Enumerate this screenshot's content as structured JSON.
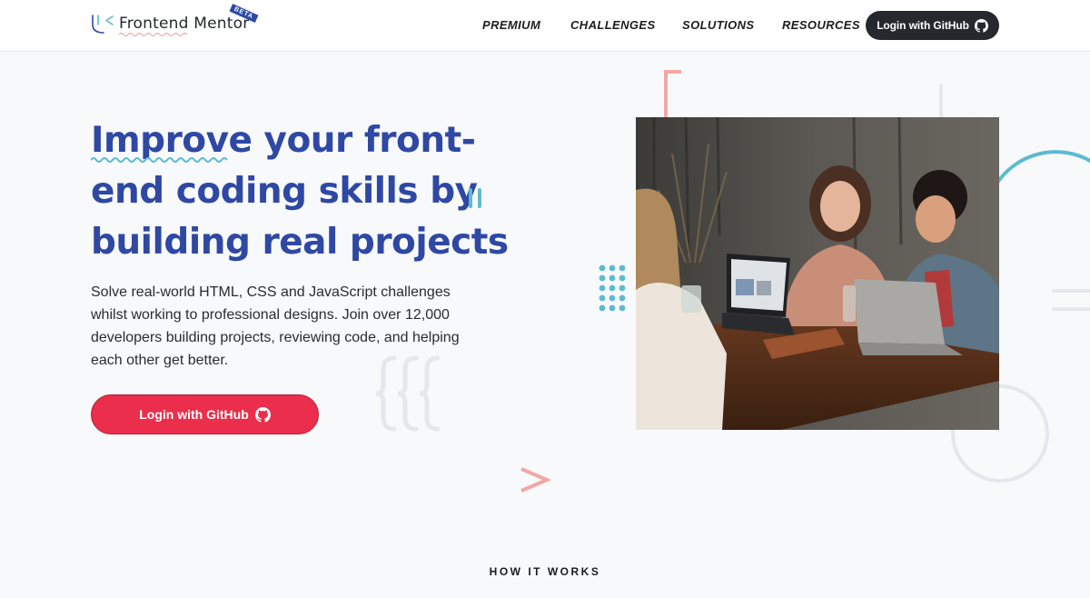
{
  "header": {
    "logo_text": "Frontend Mentor",
    "beta_badge": "BETA",
    "nav": [
      "PREMIUM",
      "CHALLENGES",
      "SOLUTIONS",
      "RESOURCES"
    ],
    "login_button": "Login with GitHub"
  },
  "hero": {
    "title_word1": "Improve",
    "title_rest": " your front-end coding skills by building real projects",
    "description": "Solve real-world HTML, CSS and JavaScript challenges whilst working to professional designs. Join over 12,000 developers building projects, reviewing code, and helping each other get better.",
    "login_button": "Login with GitHub"
  },
  "section": {
    "how_it_works": "HOW IT WORKS"
  },
  "colors": {
    "brand_blue": "#2e48a4",
    "accent_red": "#ea2e4b",
    "accent_teal": "#5cbbd0",
    "accent_pink": "#f3a6a6"
  },
  "icons": [
    "github-icon",
    "logo-mark-icon"
  ]
}
